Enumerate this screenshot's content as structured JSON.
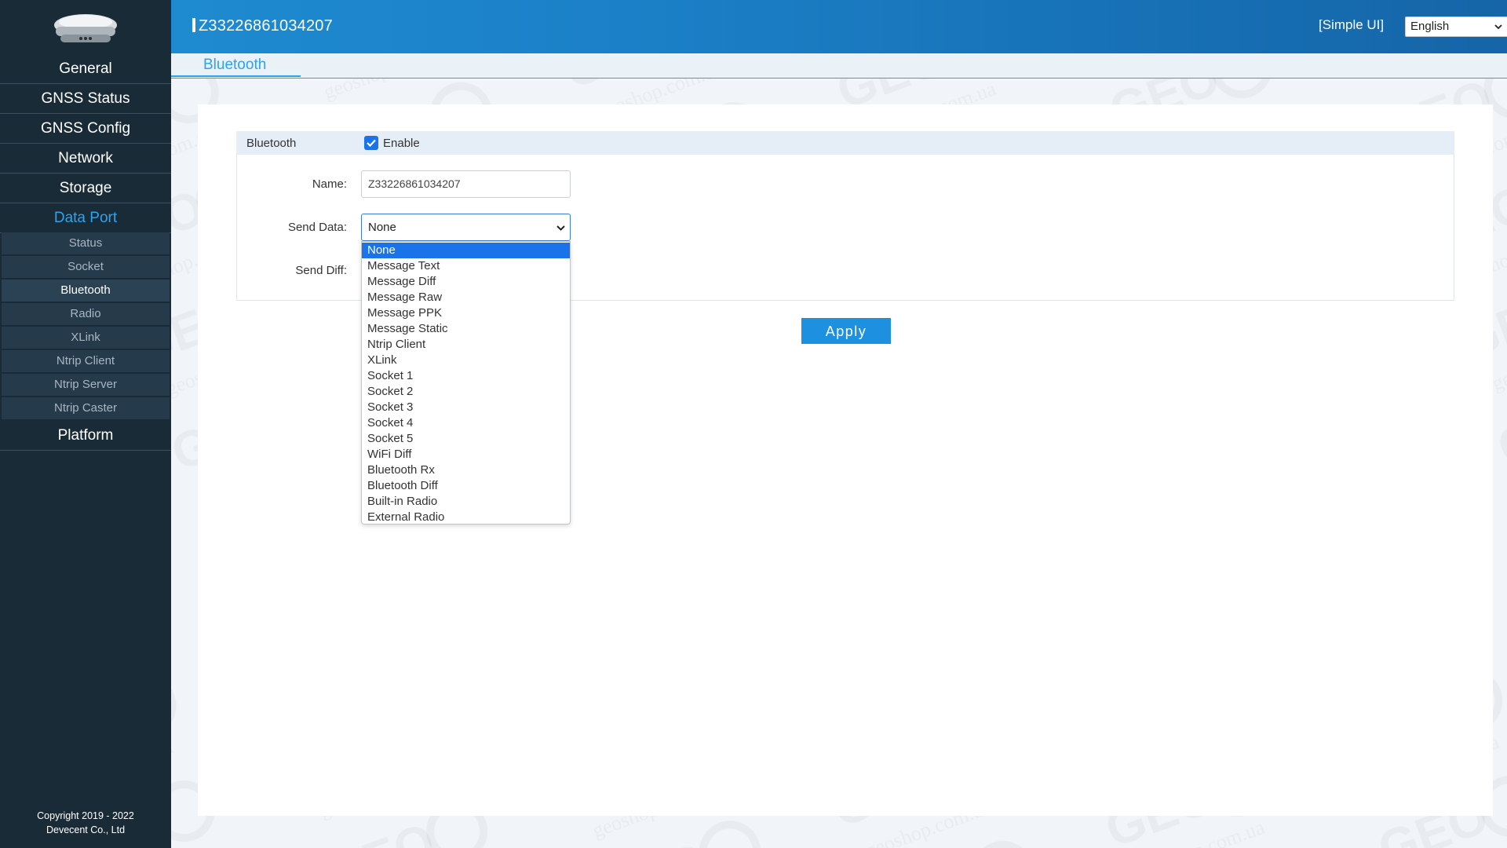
{
  "header": {
    "device_sn": "Z33226861034207",
    "simple_ui": "[Simple UI]",
    "language": "English"
  },
  "sidebar": {
    "items": [
      {
        "label": "General"
      },
      {
        "label": "GNSS Status"
      },
      {
        "label": "GNSS Config"
      },
      {
        "label": "Network"
      },
      {
        "label": "Storage"
      },
      {
        "label": "Data Port"
      },
      {
        "label": "Platform"
      }
    ],
    "sub_items": [
      {
        "label": "Status"
      },
      {
        "label": "Socket"
      },
      {
        "label": "Bluetooth"
      },
      {
        "label": "Radio"
      },
      {
        "label": "XLink"
      },
      {
        "label": "Ntrip Client"
      },
      {
        "label": "Ntrip Server"
      },
      {
        "label": "Ntrip Caster"
      }
    ],
    "copyright_line1": "Copyright 2019 - 2022",
    "copyright_line2": "Devecent Co., Ltd"
  },
  "tab": {
    "label": "Bluetooth"
  },
  "form": {
    "section_title": "Bluetooth",
    "enable_label": "Enable",
    "enable_checked": true,
    "name_label": "Name:",
    "name_value": "Z33226861034207",
    "send_data_label": "Send Data:",
    "send_data_value": "None",
    "send_diff_label": "Send Diff:",
    "apply_label": "Apply"
  },
  "dropdown": {
    "options": [
      "None",
      "Message Text",
      "Message Diff",
      "Message Raw",
      "Message PPK",
      "Message Static",
      "Ntrip Client",
      "XLink",
      "Socket 1",
      "Socket 2",
      "Socket 3",
      "Socket 4",
      "Socket 5",
      "WiFi Diff",
      "Bluetooth Rx",
      "Bluetooth Diff",
      "Built-in Radio",
      "External Radio"
    ]
  },
  "colors": {
    "accent": "#2aa3f0",
    "sidebar_bg": "#1a2b38",
    "header_blue": "#1b7fc6",
    "apply_bg": "#1e90e0",
    "selected_option": "#1a73e8"
  },
  "watermark": "geoshop.com.ua"
}
